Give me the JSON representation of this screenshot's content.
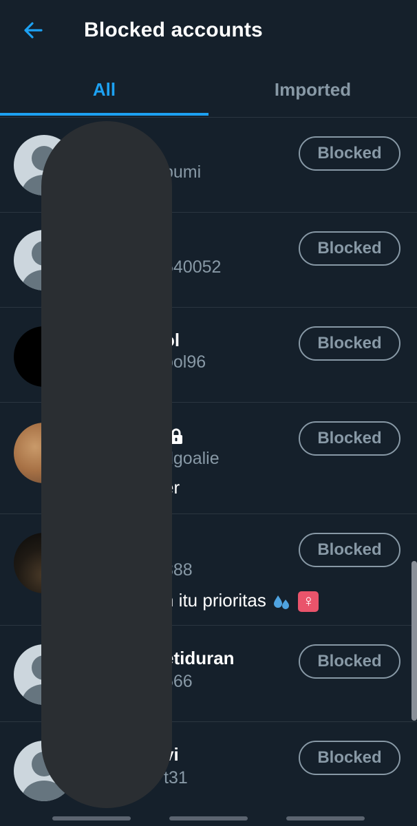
{
  "header": {
    "title": "Blocked accounts",
    "back_icon": "arrow-left-icon"
  },
  "tabs": [
    {
      "label": "All",
      "active": true
    },
    {
      "label": "Imported",
      "active": false
    }
  ],
  "accent_color": "#1da1f2",
  "accounts": [
    {
      "name": "",
      "handle": "bumi",
      "bio": "",
      "button": "Blocked"
    },
    {
      "name": "",
      "handle": "540052",
      "bio": "",
      "button": "Blocked"
    },
    {
      "name": "ol",
      "handle": "ool96",
      "bio": "",
      "button": "Blocked"
    },
    {
      "name": "",
      "handle": "dgoalie",
      "bio": "er",
      "button": "Blocked",
      "protected": true
    },
    {
      "name": "",
      "handle": "888",
      "bio": "n itu prioritas",
      "bio_emoji": "💦♀",
      "button": "Blocked"
    },
    {
      "name": "etiduran",
      "handle": "566",
      "bio": "",
      "button": "Blocked"
    },
    {
      "name": "vi",
      "handle": "t31",
      "bio": "",
      "button": "Blocked"
    }
  ]
}
